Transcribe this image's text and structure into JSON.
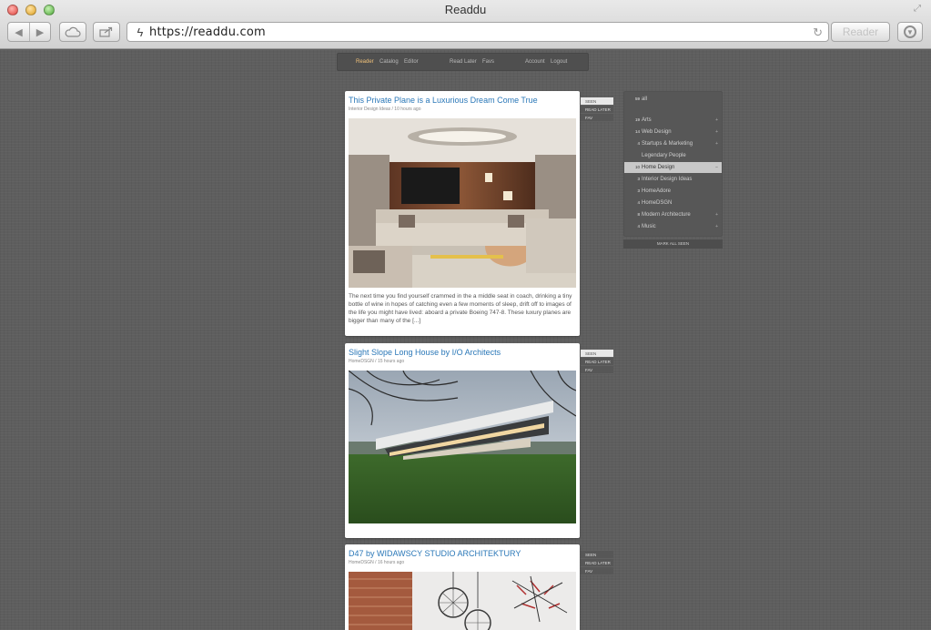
{
  "window": {
    "title": "Readdu",
    "url": "https://readdu.com",
    "reader_label": "Reader"
  },
  "nav": {
    "reader": "Reader",
    "catalog": "Catalog",
    "editor": "Editor",
    "read_later": "Read Later",
    "favs": "Favs",
    "account": "Account",
    "logout": "Logout"
  },
  "articles": [
    {
      "title": "This Private Plane is a Luxurious Dream Come True",
      "meta": "Interior Design Ideas / 10 hours ago",
      "text": "The next time you find yourself crammed in the a middle seat in coach, drinking a tiny bottle of wine in hopes of catching even a few moments of sleep, drift off to images of the life you might have lived: aboard a private Boeing 747-8. These luxury planes are bigger than many of the [...]",
      "actions": [
        "SEEN",
        "READ LATER",
        "FAV"
      ]
    },
    {
      "title": "Slight Slope Long House by I/O Architects",
      "meta": "HomeDSGN / 15 hours ago",
      "actions": [
        "SEEN",
        "READ LATER",
        "FAV"
      ]
    },
    {
      "title": "D47 by WIDAWSCY STUDIO ARCHITEKTURY",
      "meta": "HomeDSGN / 16 hours ago",
      "actions": [
        "SEEN",
        "READ LATER",
        "FAV"
      ]
    }
  ],
  "sidebar": {
    "items": [
      {
        "count": "59",
        "name": "all",
        "arrow": ""
      },
      {
        "count": "19",
        "name": "Arts",
        "arrow": "+"
      },
      {
        "count": "14",
        "name": "Web Design",
        "arrow": "+"
      },
      {
        "count": "4",
        "name": "Startups & Marketing",
        "arrow": "+"
      },
      {
        "count": "",
        "name": "Legendary People",
        "arrow": ""
      },
      {
        "count": "10",
        "name": "Home Design",
        "arrow": "−"
      },
      {
        "count": "3",
        "name": "Interior Design Ideas",
        "arrow": ""
      },
      {
        "count": "3",
        "name": "HomeAdore",
        "arrow": ""
      },
      {
        "count": "4",
        "name": "HomeDSGN",
        "arrow": ""
      },
      {
        "count": "8",
        "name": "Modern Architecture",
        "arrow": "+"
      },
      {
        "count": "4",
        "name": "Music",
        "arrow": "+"
      }
    ],
    "mark_all": "MARK ALL SEEN"
  },
  "colors": {
    "link": "#2b78b8",
    "nav_active": "#f2c27a",
    "background": "#5e5e5e"
  }
}
